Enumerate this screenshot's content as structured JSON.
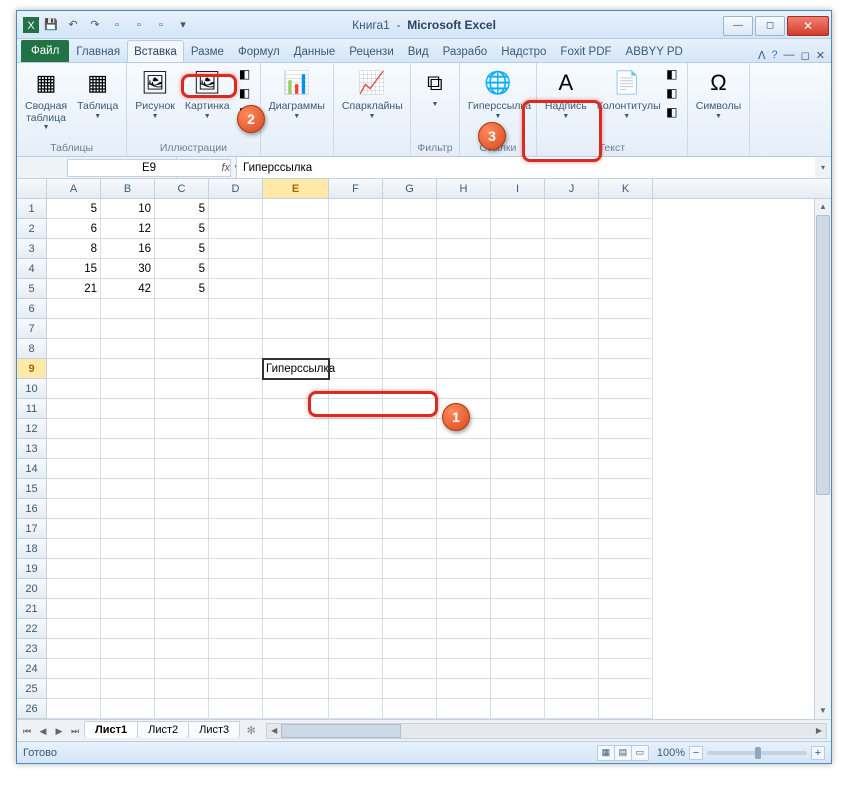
{
  "title": {
    "doc": "Книга1",
    "app": "Microsoft Excel"
  },
  "qat": [
    "save",
    "undo",
    "redo",
    "q1",
    "q2",
    "q3",
    "q4"
  ],
  "tabs": {
    "file": "Файл",
    "items": [
      "Главная",
      "Вставка",
      "Разме",
      "Формул",
      "Данные",
      "Рецензи",
      "Вид",
      "Разрабо",
      "Надстро",
      "Foxit PDF",
      "ABBYY PD"
    ],
    "active": 1
  },
  "ribbon": {
    "groups": [
      {
        "label": "Таблицы",
        "buttons": [
          {
            "name": "pivottable",
            "label": "Сводная\nтаблица",
            "glyph": "▦"
          },
          {
            "name": "table",
            "label": "Таблица",
            "glyph": "▦"
          }
        ]
      },
      {
        "label": "Иллюстрации",
        "buttons": [
          {
            "name": "picture",
            "label": "Рисунок",
            "glyph": "🖼"
          },
          {
            "name": "clipart",
            "label": "Картинка",
            "glyph": "🖼"
          }
        ],
        "smallcol": [
          "shapes",
          "smartart",
          "screenshot"
        ]
      },
      {
        "label": "",
        "buttons": [
          {
            "name": "charts",
            "label": "Диаграммы",
            "glyph": "📊"
          }
        ]
      },
      {
        "label": "",
        "buttons": [
          {
            "name": "sparklines",
            "label": "Спарклайны",
            "glyph": "📈"
          }
        ]
      },
      {
        "label": "Фильтр",
        "buttons": [
          {
            "name": "slicer",
            "label": "",
            "glyph": "⧉"
          }
        ]
      },
      {
        "label": "Ссылки",
        "buttons": [
          {
            "name": "hyperlink",
            "label": "Гиперссылка",
            "glyph": "🌐"
          }
        ]
      },
      {
        "label": "Текст",
        "buttons": [
          {
            "name": "textbox",
            "label": "Надпись",
            "glyph": "A"
          },
          {
            "name": "headerfooter",
            "label": "Колонтитулы",
            "glyph": "📄"
          }
        ],
        "smallcol": [
          "wordart",
          "sigline",
          "object"
        ]
      },
      {
        "label": "",
        "buttons": [
          {
            "name": "symbols",
            "label": "Символы",
            "glyph": "Ω"
          }
        ]
      }
    ]
  },
  "namebox": "E9",
  "formula": "Гиперссылка",
  "columns": [
    "A",
    "B",
    "C",
    "D",
    "E",
    "F",
    "G",
    "H",
    "I",
    "J",
    "K"
  ],
  "selected_col": "E",
  "selected_row": 9,
  "data_rows": [
    {
      "r": 1,
      "A": 5,
      "B": 10,
      "C": 5
    },
    {
      "r": 2,
      "A": 6,
      "B": 12,
      "C": 5
    },
    {
      "r": 3,
      "A": 8,
      "B": 16,
      "C": 5
    },
    {
      "r": 4,
      "A": 15,
      "B": 30,
      "C": 5
    },
    {
      "r": 5,
      "A": 21,
      "B": 42,
      "C": 5
    }
  ],
  "active_cell": {
    "row": 9,
    "col": "E",
    "value": "Гиперссылка"
  },
  "total_rows": 27,
  "sheets": {
    "items": [
      "Лист1",
      "Лист2",
      "Лист3"
    ],
    "active": 0
  },
  "status": "Готово",
  "zoom": "100%",
  "callouts": {
    "1": "1",
    "2": "2",
    "3": "3"
  }
}
